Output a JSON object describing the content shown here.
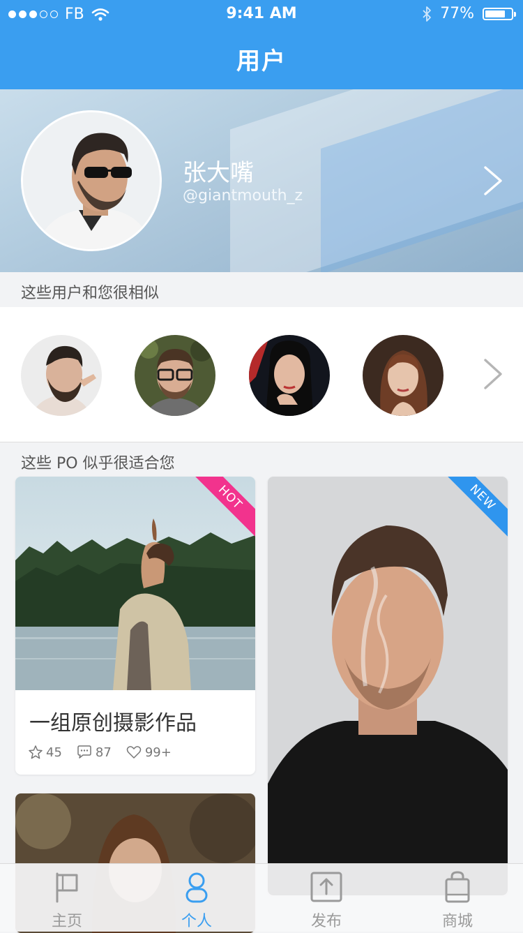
{
  "status_bar": {
    "carrier": "FB",
    "time": "9:41 AM",
    "battery": "77%",
    "battery_level": 0.77
  },
  "nav": {
    "title": "用户"
  },
  "profile": {
    "name": "张大嘴",
    "handle": "@giantmouth_z"
  },
  "similar_users": {
    "heading": "这些用户和您很相似",
    "count": 4
  },
  "posts": {
    "heading": "这些 PO 似乎很适合您",
    "items": [
      {
        "badge": "HOT",
        "badge_color": "#f2338d",
        "title": "一组原创摄影作品",
        "stars": "45",
        "comments": "87",
        "likes": "99+"
      },
      {
        "badge": "NEW",
        "badge_color": "#2f95ee"
      }
    ]
  },
  "tabbar": {
    "active_color": "#3a9ef0",
    "inactive_color": "#9a9a9a",
    "items": [
      {
        "label": "主页",
        "icon": "flag-icon"
      },
      {
        "label": "个人",
        "icon": "person-icon"
      },
      {
        "label": "发布",
        "icon": "upload-icon"
      },
      {
        "label": "商城",
        "icon": "shopping-bag-icon"
      }
    ]
  }
}
